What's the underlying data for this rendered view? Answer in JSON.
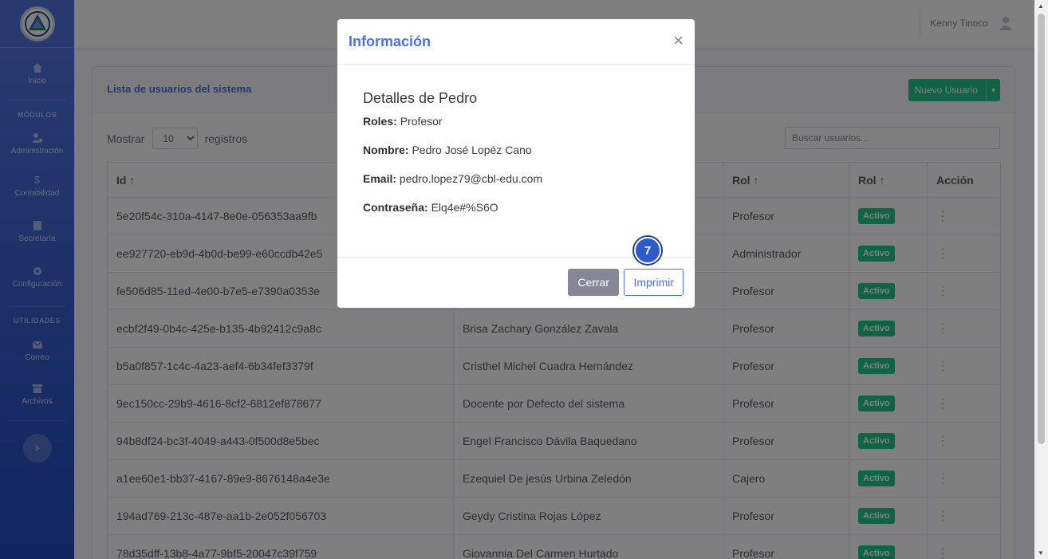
{
  "user": {
    "name": "Kenny Tinoco",
    "icon": "user-icon"
  },
  "sidebar": {
    "items": [
      {
        "label": "Inicio",
        "icon": "home-icon"
      },
      {
        "heading": "MÓDULOS"
      },
      {
        "label": "Administración",
        "icon": "users-cog-icon"
      },
      {
        "label": "Contabilidad",
        "icon": "dollar-icon"
      },
      {
        "label": "Secretaría",
        "icon": "document-icon"
      },
      {
        "label": "Configuración",
        "icon": "gear-icon"
      },
      {
        "heading": "UTILIDADES"
      },
      {
        "label": "Correo",
        "icon": "envelope-icon"
      },
      {
        "label": "Archivos",
        "icon": "archive-icon"
      }
    ],
    "toggle_icon": "chevron-right-icon"
  },
  "card": {
    "title": "Lista de usuarios del sistema",
    "new_button": "Nuevo Usuario",
    "show_label": "Mostrar",
    "show_value": "10",
    "records_label": "registros",
    "search_placeholder": "Buscar usuarios..."
  },
  "table": {
    "headers": [
      "Id ↑",
      "",
      "Rol ↑",
      "Rol ↑",
      "Acción"
    ],
    "rows": [
      {
        "id": "5e20f54c-310a-4147-8e0e-056353aa9fb",
        "name": "",
        "role": "Profesor",
        "status": "Activo"
      },
      {
        "id": "ee927720-eb9d-4b0d-be99-e60ccdb42e5",
        "name": "",
        "role": "Administrador",
        "status": "Activo"
      },
      {
        "id": "fe506d85-11ed-4e00-b7e5-e7390a0353e",
        "name": "",
        "role": "Profesor",
        "status": "Activo"
      },
      {
        "id": "ecbf2f49-0b4c-425e-b135-4b92412c9a8c",
        "name": "Brisa Zachary González Zavala",
        "role": "Profesor",
        "status": "Activo"
      },
      {
        "id": "b5a0f857-1c4c-4a23-aef4-6b34fef3379f",
        "name": "Cristhel Michel Cuadra Hernández",
        "role": "Profesor",
        "status": "Activo"
      },
      {
        "id": "9ec150cc-29b9-4616-8cf2-6812ef878677",
        "name": "Docente por Defecto del sistema",
        "role": "Profesor",
        "status": "Activo"
      },
      {
        "id": "94b8df24-bc3f-4049-a443-0f500d8e5bec",
        "name": "Engel Francisco Dávila Baquedano",
        "role": "Profesor",
        "status": "Activo"
      },
      {
        "id": "a1ee60e1-bb37-4167-89e9-8676148a4e3e",
        "name": "Ezequiel De jesús Urbina Zeledón",
        "role": "Cajero",
        "status": "Activo"
      },
      {
        "id": "194ad769-213c-487e-aa1b-2e052f056703",
        "name": "Geydy Cristina Rojas López",
        "role": "Profesor",
        "status": "Activo"
      },
      {
        "id": "78d35dff-13b8-4a77-9bf5-20047c39f759",
        "name": "Giovannia Del Carmen Hurtado",
        "role": "Profesor",
        "status": "Activo"
      }
    ]
  },
  "modal": {
    "title": "Información",
    "close_symbol": "×",
    "detail_title": "Detalles de Pedro",
    "fields": [
      {
        "label": "Roles:",
        "value": "Profesor"
      },
      {
        "label": "Nombre:",
        "value": "Pedro José Lopéz Cano"
      },
      {
        "label": "Email:",
        "value": "pedro.lopez79@cbl-edu.com"
      },
      {
        "label": "Contraseña:",
        "value": "Elq4e#%S6O"
      }
    ],
    "close_button": "Cerrar",
    "print_button": "Imprimir"
  },
  "step_marker": "7",
  "colors": {
    "primary": "#4e73df",
    "success": "#1cc88a",
    "secondary": "#858796"
  }
}
